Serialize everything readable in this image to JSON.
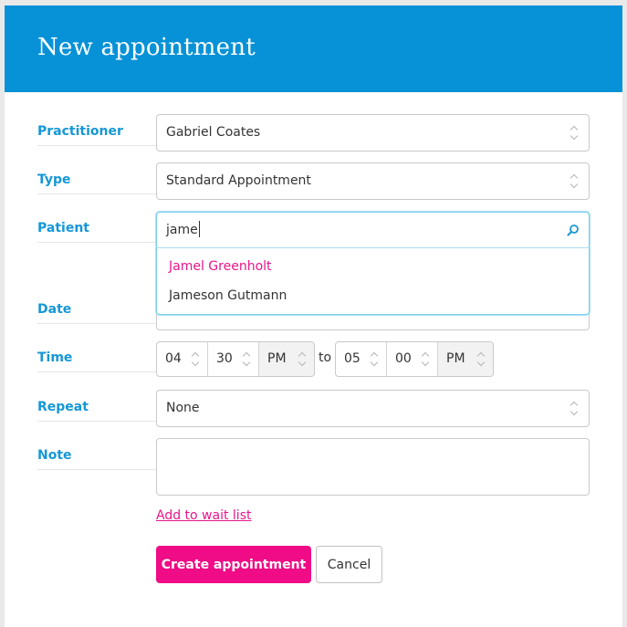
{
  "header": {
    "title": "New appointment"
  },
  "form": {
    "practitioner": {
      "label": "Practitioner",
      "value": "Gabriel Coates"
    },
    "type": {
      "label": "Type",
      "value": "Standard Appointment"
    },
    "patient": {
      "label": "Patient",
      "value": "jame",
      "suggestions": [
        "Jamel Greenholt",
        "Jameson Gutmann"
      ]
    },
    "date": {
      "label": "Date"
    },
    "time": {
      "label": "Time",
      "start": {
        "hour": "04",
        "minute": "30",
        "ampm": "PM"
      },
      "to": "to",
      "end": {
        "hour": "05",
        "minute": "00",
        "ampm": "PM"
      }
    },
    "repeat": {
      "label": "Repeat",
      "value": "None"
    },
    "note": {
      "label": "Note",
      "value": ""
    }
  },
  "links": {
    "waitlist": "Add to wait list"
  },
  "actions": {
    "create": "Create appointment",
    "cancel": "Cancel"
  },
  "colors": {
    "header_bg": "#0792d8",
    "label": "#1697d6",
    "accent": "#ef0c86",
    "link": "#e8168a"
  },
  "icons": {
    "patient_search": "search-icon",
    "select": "up-down-caret-icon"
  }
}
